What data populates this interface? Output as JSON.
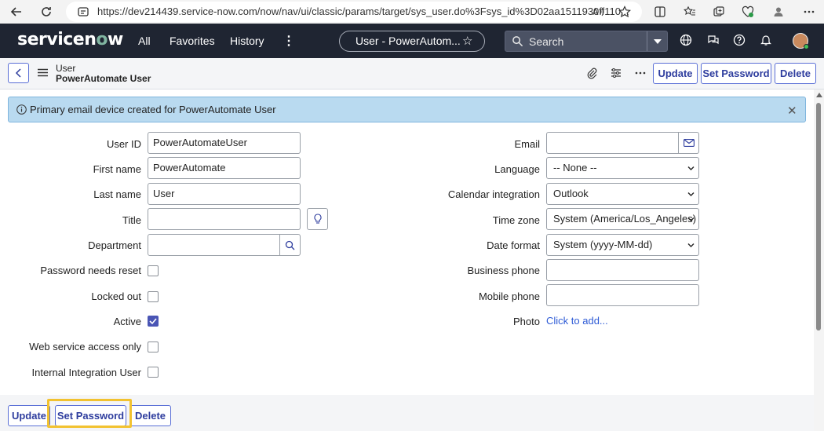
{
  "browser": {
    "url": "https://dev214439.service-now.com/now/nav/ui/classic/params/target/sys_user.do%3Fsys_id%3D02aa1511930ff110..."
  },
  "header": {
    "logo": "servicenow",
    "nav": [
      "All",
      "Favorites",
      "History"
    ],
    "page_pill": "User - PowerAutom...",
    "search_placeholder": "Search"
  },
  "form_header": {
    "table_label": "User",
    "record_label": "PowerAutomate User",
    "buttons": {
      "update": "Update",
      "set_password": "Set Password",
      "delete": "Delete"
    }
  },
  "alert": {
    "message": "Primary email device created for PowerAutomate User"
  },
  "left_fields": {
    "user_id": {
      "label": "User ID",
      "value": "PowerAutomateUser"
    },
    "first_name": {
      "label": "First name",
      "value": "PowerAutomate"
    },
    "last_name": {
      "label": "Last name",
      "value": "User"
    },
    "title": {
      "label": "Title",
      "value": ""
    },
    "department": {
      "label": "Department",
      "value": ""
    },
    "password_needs_reset": {
      "label": "Password needs reset",
      "checked": false
    },
    "locked_out": {
      "label": "Locked out",
      "checked": false
    },
    "active": {
      "label": "Active",
      "checked": true
    },
    "web_service_access_only": {
      "label": "Web service access only",
      "checked": false
    },
    "internal_integration_user": {
      "label": "Internal Integration User",
      "checked": false
    }
  },
  "right_fields": {
    "email": {
      "label": "Email",
      "value": ""
    },
    "language": {
      "label": "Language",
      "value": "-- None --"
    },
    "calendar_integration": {
      "label": "Calendar integration",
      "value": "Outlook"
    },
    "time_zone": {
      "label": "Time zone",
      "value": "System (America/Los_Angeles)"
    },
    "date_format": {
      "label": "Date format",
      "value": "System (yyyy-MM-dd)"
    },
    "business_phone": {
      "label": "Business phone",
      "value": ""
    },
    "mobile_phone": {
      "label": "Mobile phone",
      "value": ""
    },
    "photo": {
      "label": "Photo",
      "link": "Click to add..."
    }
  },
  "footer_buttons": {
    "update": "Update",
    "set_password": "Set Password",
    "delete": "Delete"
  },
  "colors": {
    "header_bg": "#1f2532",
    "accent": "#2e3d9e",
    "alert_bg": "#b9daf0",
    "highlight": "#f2c230"
  }
}
